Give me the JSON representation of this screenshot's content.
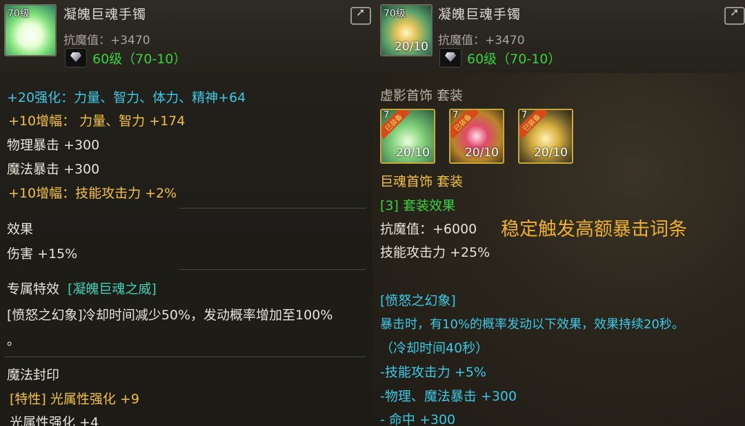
{
  "left": {
    "item": {
      "level_tag": "70级",
      "name": "凝魄巨魂手镯",
      "stat": "抗魔值：+3470",
      "grade": "60级（70-10）"
    },
    "lines": {
      "enhance": "+20强化：力量、智力、体力、精神+64",
      "amp1": "+10增幅：  力量、智力 +174",
      "phys_crit": "物理暴击 +300",
      "magic_crit": "魔法暴击 +300",
      "amp2": "+10增幅：技能攻击力 +2%",
      "effect_title": "效果",
      "effect_value": "伤害 +15%",
      "exclusive_title": "专属特效",
      "exclusive_name": "[凝魄巨魂之威]",
      "exclusive_desc1": "[愤怒之幻象]冷却时间减少50%，发动概率增加至100%",
      "exclusive_desc2": "。",
      "seal_title": "魔法封印",
      "seal_line1": "[特性] 光属性强化 +9",
      "seal_line2": "光属性强化 +4"
    }
  },
  "right": {
    "item": {
      "level_tag": "70级",
      "big_num": "20/10",
      "name": "凝魄巨魂手镯",
      "stat": "抗魔值：+3470",
      "grade": "60级（70-10）"
    },
    "lines": {
      "set_title1": "虚影首饰  套装",
      "set_icons": [
        {
          "level_tag": "7",
          "badge": "已装备",
          "big_num": "20/10"
        },
        {
          "level_tag": "7",
          "badge": "已装备",
          "big_num": "20/10"
        },
        {
          "level_tag": "7",
          "badge": "已装备",
          "big_num": "20/10"
        }
      ],
      "set_title2": "巨魂首饰  套装",
      "set_effect_title": "[3] 套装效果",
      "set_stat1": "抗魔值：+6000",
      "highlight": "稳定触发高额暴击词条",
      "set_stat2": "技能攻击力 +25%",
      "proc_title": "[愤怒之幻象]",
      "proc_desc": "暴击时，有10%的概率发动以下效果，效果持续20秒。",
      "proc_cd": "（冷却时间40秒）",
      "proc_e1": "-技能攻击力 +5%",
      "proc_e2": "-物理、魔法暴击 +300",
      "proc_e3": "- 命中 +300"
    }
  },
  "colors": {
    "cyan": "#38c9e6",
    "yellow": "#f3c23a",
    "green": "#3ad23a",
    "gold": "#f0b12a",
    "teal": "#3fd2b4"
  }
}
